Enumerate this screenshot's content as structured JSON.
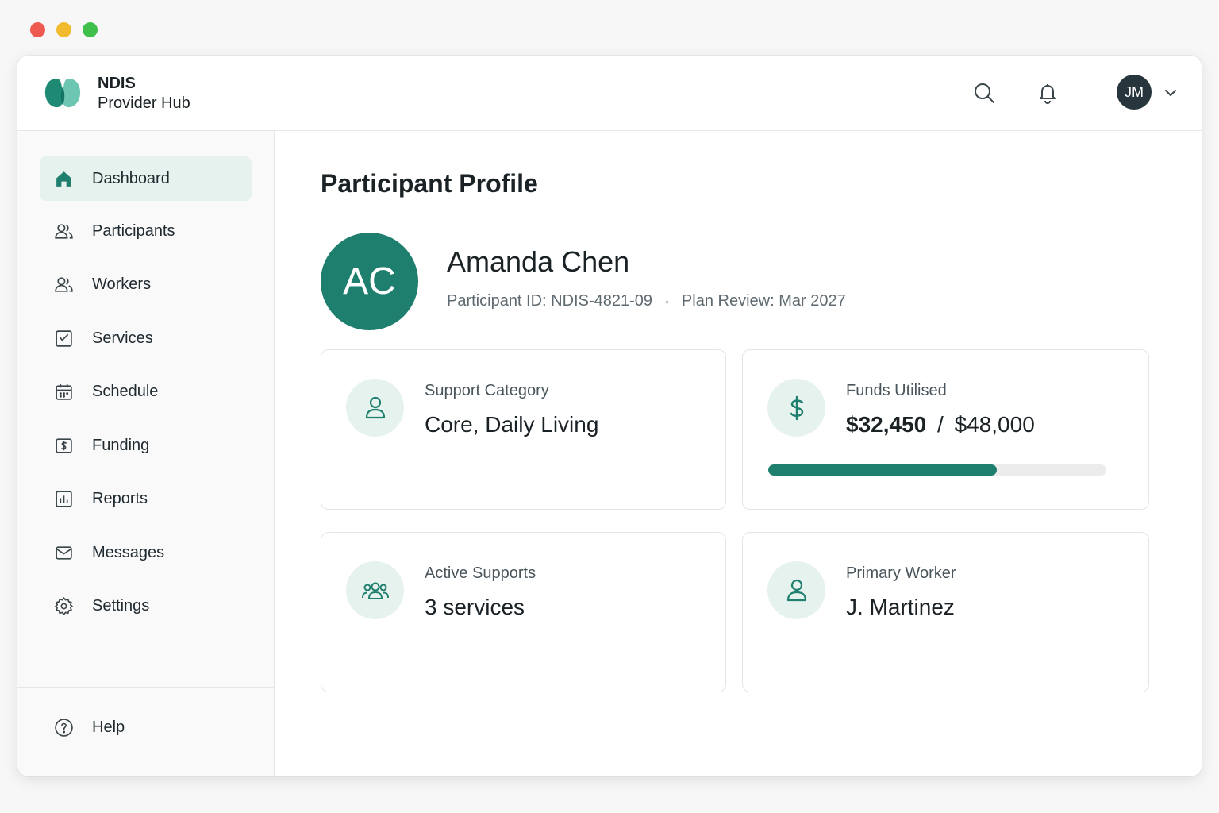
{
  "app": {
    "brand_line1": "NDIS",
    "brand_line2": "Provider Hub",
    "user_initials": "JM",
    "accent_color": "#1f7f6e"
  },
  "header": {
    "icons": [
      "search-icon",
      "bell-icon",
      "chevron-down-icon"
    ]
  },
  "sidebar": {
    "items": [
      {
        "label": "Dashboard",
        "icon": "home-icon",
        "active": true
      },
      {
        "label": "Participants",
        "icon": "users-icon"
      },
      {
        "label": "Workers",
        "icon": "users-icon"
      },
      {
        "label": "Services",
        "icon": "services-icon"
      },
      {
        "label": "Schedule",
        "icon": "calendar-icon"
      },
      {
        "label": "Funding",
        "icon": "funding-icon"
      },
      {
        "label": "Reports",
        "icon": "report-icon"
      },
      {
        "label": "Messages",
        "icon": "mail-icon"
      },
      {
        "label": "Settings",
        "icon": "gear-icon"
      }
    ],
    "help_label": "Help"
  },
  "main": {
    "title": "Participant Profile",
    "participant": {
      "initials": "AC",
      "name": "Amanda Chen",
      "id_text": "Participant ID: NDIS-4821-09",
      "plan_review": "Plan Review: Mar 2027"
    },
    "cards": {
      "support": {
        "label": "Support Category",
        "value": "Core, Daily Living",
        "icon": "person-icon"
      },
      "funds": {
        "label": "Funds Utilised",
        "used": "$32,450",
        "separator": "/",
        "total": "$48,000",
        "progress_fraction": 0.676,
        "icon": "dollar-icon"
      },
      "active": {
        "label": "Active Supports",
        "value": "3 services",
        "icon": "group-icon"
      },
      "worker": {
        "label": "Primary Worker",
        "value": "J. Martinez",
        "icon": "person-icon"
      }
    }
  }
}
